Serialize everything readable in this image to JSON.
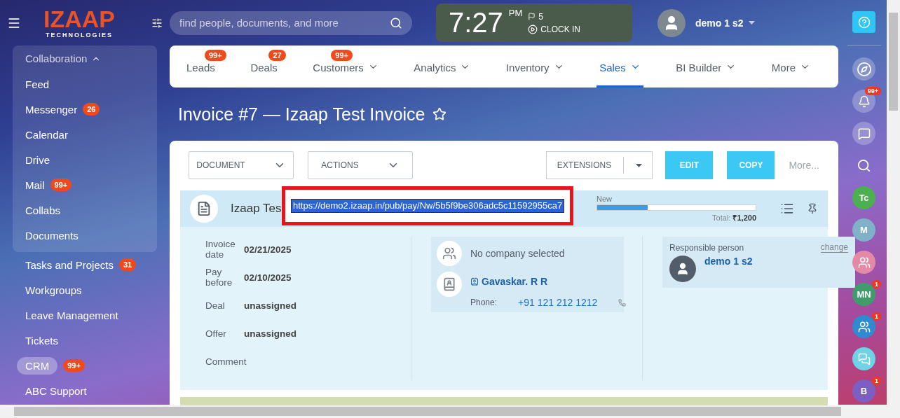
{
  "header": {
    "logo": {
      "mark": "IZAAP",
      "tagline": "TECHNOLOGIES"
    },
    "search": {
      "placeholder": "find people, documents, and more"
    },
    "clock": {
      "time": "7:27",
      "period": "PM",
      "flags": "5",
      "action": "CLOCK IN"
    },
    "user": {
      "name": "demo 1 s2"
    }
  },
  "sidebar": {
    "group": {
      "title": "Collaboration",
      "expanded": true,
      "items": [
        {
          "label": "Feed",
          "selected": false
        },
        {
          "label": "Messenger",
          "badge": "26",
          "selected": false
        },
        {
          "label": "Calendar",
          "selected": false
        },
        {
          "label": "Drive",
          "selected": false
        },
        {
          "label": "Mail",
          "badge": "99+",
          "selected": false
        },
        {
          "label": "Collabs",
          "selected": false
        },
        {
          "label": "Documents",
          "selected": false
        }
      ]
    },
    "items": [
      {
        "label": "Tasks and Projects",
        "badge": "31",
        "selected": false
      },
      {
        "label": "Workgroups",
        "selected": false
      },
      {
        "label": "Leave Management",
        "selected": false
      },
      {
        "label": "Tickets",
        "selected": false
      },
      {
        "label": "CRM",
        "badge": "99+",
        "selected": true
      },
      {
        "label": "ABC Support",
        "selected": false
      }
    ]
  },
  "nav": [
    {
      "label": "Leads",
      "badge": "99+",
      "dropdown": false,
      "selected": false
    },
    {
      "label": "Deals",
      "badge": "27",
      "dropdown": false,
      "selected": false
    },
    {
      "label": "Customers",
      "badge": "99+",
      "dropdown": true,
      "selected": false
    },
    {
      "label": "Analytics",
      "dropdown": true,
      "selected": false
    },
    {
      "label": "Inventory",
      "dropdown": true,
      "selected": false
    },
    {
      "label": "Sales",
      "dropdown": true,
      "selected": true
    },
    {
      "label": "BI Builder",
      "dropdown": true,
      "selected": false
    },
    {
      "label": "More",
      "dropdown": true,
      "selected": false
    }
  ],
  "page_title": "Invoice #7 — Izaap Test Invoice",
  "toolbar": [
    {
      "label": "DOCUMENT",
      "kind": "dropdown"
    },
    {
      "label": "ACTIONS",
      "kind": "dropdown"
    },
    {
      "label": "EXTENSIONS",
      "kind": "split"
    },
    {
      "label": "EDIT",
      "kind": "primary"
    },
    {
      "label": "COPY",
      "kind": "primary"
    },
    {
      "label": "More...",
      "kind": "link"
    }
  ],
  "summary": {
    "title": "Izaap Tes",
    "stage": "New",
    "level": 0.32,
    "total_label": "Total:",
    "total": "₹1,200"
  },
  "url_popup": {
    "value": "https://demo2.izaap.in/pub/pay/Nw/5b5f9be306adc5c11592955ca7"
  },
  "details": [
    {
      "label": "Invoice date",
      "value": "02/21/2025"
    },
    {
      "label": "Pay before",
      "value": "02/10/2025"
    },
    {
      "label": "Deal",
      "value": "unassigned"
    },
    {
      "label": "Offer",
      "value": "unassigned"
    },
    {
      "label": "Comment"
    }
  ],
  "contact": {
    "company": "No company selected",
    "name": "Gavaskar. R R",
    "phone_label": "Phone:",
    "phone": "+91 121 212 1212"
  },
  "responsible": {
    "title": "Responsible person",
    "change": "change",
    "name": "demo 1 s2"
  },
  "rail": [
    {
      "kind": "compass"
    },
    {
      "kind": "bell",
      "badge": "99+"
    },
    {
      "kind": "chat"
    },
    {
      "kind": "search"
    },
    {
      "kind": "avatar",
      "initials": "Tc",
      "color": "#4caf50"
    },
    {
      "kind": "avatar",
      "initials": "M",
      "color": "#7fb1c9"
    },
    {
      "kind": "group",
      "color": "#e58aa6"
    },
    {
      "kind": "avatar",
      "initials": "MN",
      "color": "#3f9d6b",
      "badge": "1"
    },
    {
      "kind": "group",
      "color": "#2f8ad0",
      "badge": "1"
    },
    {
      "kind": "bubble",
      "color": "#6fd3e8"
    },
    {
      "kind": "avatar",
      "initials": "B",
      "color": "#7d5fc4",
      "badge": "1"
    }
  ]
}
